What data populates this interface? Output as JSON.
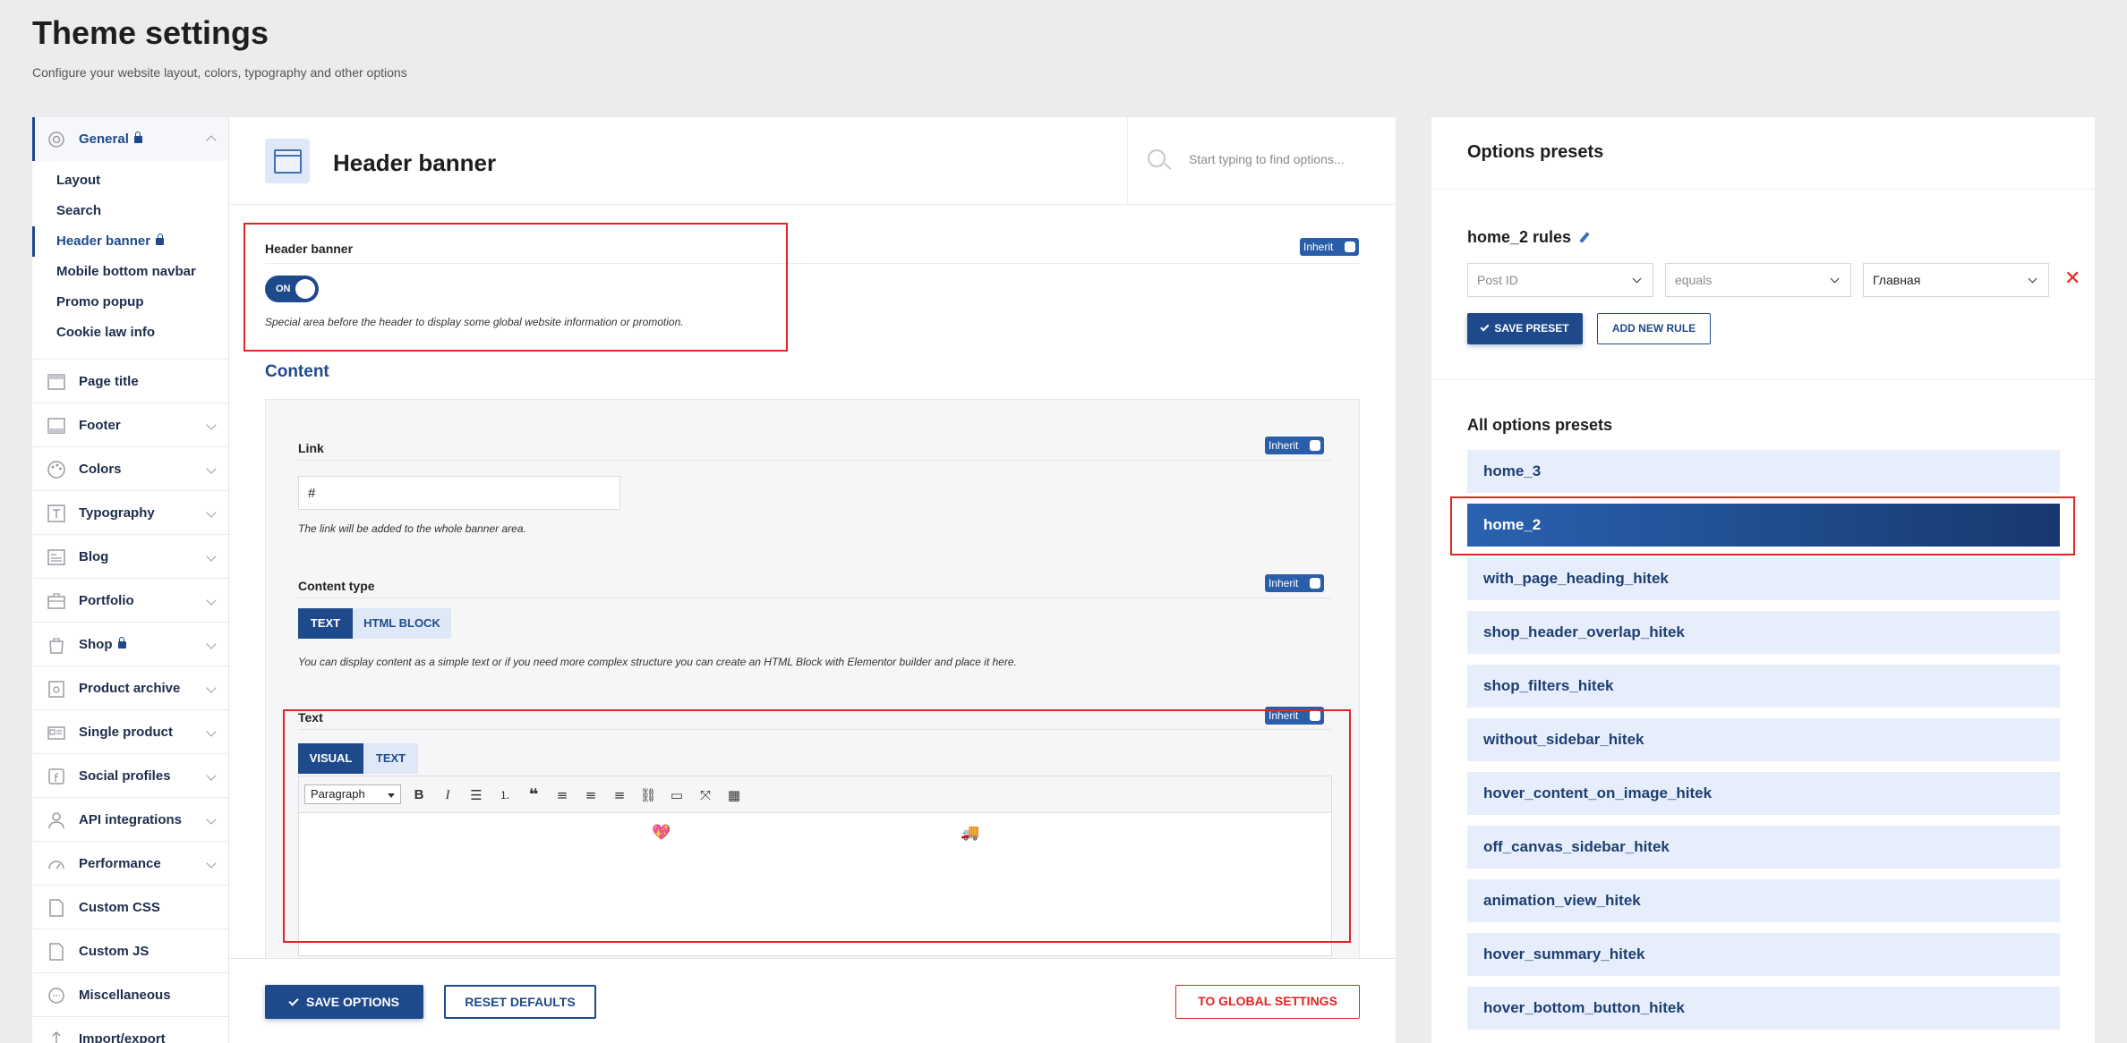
{
  "page": {
    "title": "Theme settings",
    "subtitle": "Configure your website layout, colors, typography and other options"
  },
  "sidebar": {
    "general_label": "General",
    "sub_items": [
      "Layout",
      "Search",
      "Header banner",
      "Mobile bottom navbar",
      "Promo popup",
      "Cookie law info"
    ],
    "items": [
      {
        "label": "Page title",
        "icon": "page-title-icon"
      },
      {
        "label": "Footer",
        "icon": "footer-icon"
      },
      {
        "label": "Colors",
        "icon": "palette-icon"
      },
      {
        "label": "Typography",
        "icon": "typography-icon"
      },
      {
        "label": "Blog",
        "icon": "blog-icon"
      },
      {
        "label": "Portfolio",
        "icon": "briefcase-icon"
      },
      {
        "label": "Shop",
        "icon": "shopping-bag-icon"
      },
      {
        "label": "Product archive",
        "icon": "product-archive-icon"
      },
      {
        "label": "Single product",
        "icon": "single-product-icon"
      },
      {
        "label": "Social profiles",
        "icon": "social-icon"
      },
      {
        "label": "API integrations",
        "icon": "api-icon"
      },
      {
        "label": "Performance",
        "icon": "gauge-icon"
      },
      {
        "label": "Custom CSS",
        "icon": "css-file-icon"
      },
      {
        "label": "Custom JS",
        "icon": "js-file-icon"
      },
      {
        "label": "Miscellaneous",
        "icon": "dots-icon"
      },
      {
        "label": "Import/export",
        "icon": "import-export-icon"
      }
    ]
  },
  "main": {
    "title": "Header banner",
    "search_placeholder": "Start typing to find options...",
    "inherit_label": "Inherit",
    "banner": {
      "label": "Header banner",
      "toggle_label": "ON",
      "help": "Special area before the header to display some global website information or promotion."
    },
    "content_title": "Content",
    "link": {
      "label": "Link",
      "value": "#",
      "help": "The link will be added to the whole banner area."
    },
    "content_type": {
      "label": "Content type",
      "options": [
        "TEXT",
        "HTML BLOCK"
      ],
      "selected": "TEXT",
      "help": "You can display content as a simple text or if you need more complex structure you can create an HTML Block with Elementor builder and place it here."
    },
    "text": {
      "label": "Text",
      "tabs": [
        "VISUAL",
        "TEXT"
      ],
      "format_select": "Paragraph",
      "emoji_1": "💖",
      "emoji_2": "🚚"
    },
    "footer": {
      "save_label": "SAVE OPTIONS",
      "reset_label": "RESET DEFAULTS",
      "global_label": "TO GLOBAL SETTINGS"
    }
  },
  "presets": {
    "title": "Options presets",
    "rules_title": "home_2 rules",
    "rule": {
      "field": "Post ID",
      "operator": "equals",
      "value": "Главная"
    },
    "save_label": "SAVE PRESET",
    "add_rule_label": "ADD NEW RULE",
    "all_title": "All options presets",
    "items": [
      "home_3",
      "home_2",
      "with_page_heading_hitek",
      "shop_header_overlap_hitek",
      "shop_filters_hitek",
      "without_sidebar_hitek",
      "hover_content_on_image_hitek",
      "off_canvas_sidebar_hitek",
      "animation_view_hitek",
      "hover_summary_hitek",
      "hover_bottom_button_hitek"
    ],
    "active_item": "home_2"
  },
  "colors": {
    "accent": "#1e4a8c",
    "highlight_border": "#e42323",
    "preset_bg": "#e7eefb"
  }
}
